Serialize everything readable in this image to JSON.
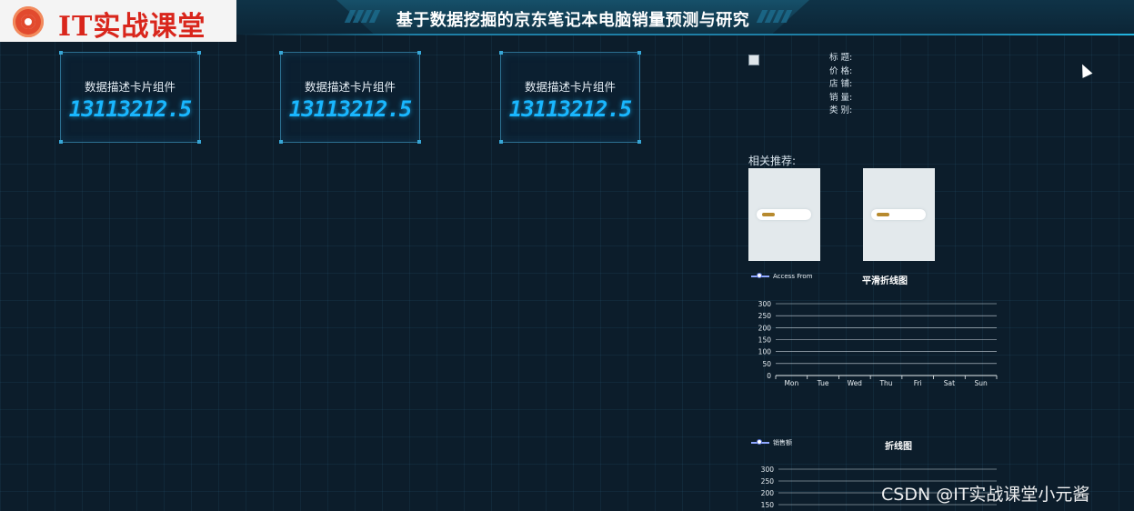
{
  "header": {
    "logo_text": "IT实战课堂",
    "title": "基于数据挖掘的京东笔记本电脑销量预测与研究"
  },
  "cards": [
    {
      "title": "数据描述卡片组件",
      "value": "13113212.5"
    },
    {
      "title": "数据描述卡片组件",
      "value": "13113212.5"
    },
    {
      "title": "数据描述卡片组件",
      "value": "13113212.5"
    }
  ],
  "detail": {
    "fields": [
      "标 题:",
      "价 格:",
      "店 铺:",
      "销 量:",
      "类 别:"
    ]
  },
  "recommend": {
    "title": "相关推荐:",
    "items": 2
  },
  "watermark": "CSDN @IT实战课堂小元酱",
  "chart_data": [
    {
      "type": "line",
      "title": "平滑折线图",
      "legend": "Access From",
      "categories": [
        "Mon",
        "Tue",
        "Wed",
        "Thu",
        "Fri",
        "Sat",
        "Sun"
      ],
      "yticks": [
        0,
        50,
        100,
        150,
        200,
        250,
        300
      ],
      "ylim": [
        0,
        300
      ],
      "series": [
        {
          "name": "Access From",
          "values": []
        }
      ]
    },
    {
      "type": "line",
      "title": "折线图",
      "legend": "销售额",
      "yticks": [
        150,
        200,
        250,
        300
      ],
      "ylim": [
        0,
        300
      ],
      "series": [
        {
          "name": "销售额",
          "values": []
        }
      ]
    }
  ]
}
